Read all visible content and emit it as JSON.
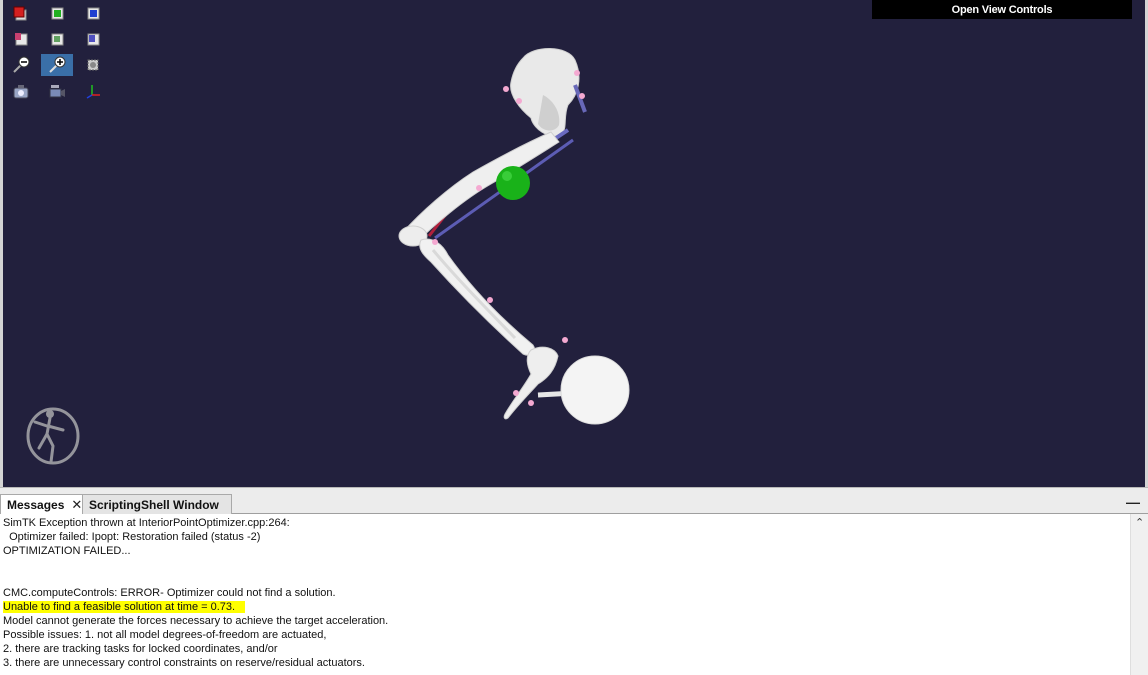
{
  "viewer": {
    "open_view_controls_label": "Open View Controls",
    "background_color": "#22203d",
    "toolbar": [
      {
        "name": "view-front-icon"
      },
      {
        "name": "view-right-icon"
      },
      {
        "name": "view-top-icon"
      },
      {
        "name": "view-back-icon"
      },
      {
        "name": "view-left-icon"
      },
      {
        "name": "view-bottom-icon"
      },
      {
        "name": "zoom-out-icon"
      },
      {
        "name": "zoom-in-icon",
        "active": true
      },
      {
        "name": "fit-view-icon"
      },
      {
        "name": "snapshot-camera-icon"
      },
      {
        "name": "record-movie-icon"
      },
      {
        "name": "axes-toggle-icon"
      }
    ]
  },
  "panel": {
    "tabs": [
      {
        "label": "Messages",
        "active": true
      },
      {
        "label": "ScriptingShell Window",
        "active": false
      }
    ],
    "minimize_label": "—",
    "messages": [
      {
        "text": "SimTK Exception thrown at InteriorPointOptimizer.cpp:264:",
        "highlight": false
      },
      {
        "text": "  Optimizer failed: Ipopt: Restoration failed (status -2)",
        "highlight": false
      },
      {
        "text": "OPTIMIZATION FAILED...",
        "highlight": false
      },
      {
        "text": "",
        "highlight": false
      },
      {
        "text": "",
        "highlight": false
      },
      {
        "text": "CMC.computeControls: ERROR- Optimizer could not find a solution.",
        "highlight": false
      },
      {
        "text": "Unable to find a feasible solution at time = 0.73.",
        "highlight": true
      },
      {
        "text": "Model cannot generate the forces necessary to achieve the target acceleration.",
        "highlight": false
      },
      {
        "text": "Possible issues: 1. not all model degrees-of-freedom are actuated,",
        "highlight": false
      },
      {
        "text": "2. there are tracking tasks for locked coordinates, and/or",
        "highlight": false
      },
      {
        "text": "3. there are unnecessary control constraints on reserve/residual actuators.",
        "highlight": false
      }
    ],
    "highlight_color": "#ffff00"
  }
}
